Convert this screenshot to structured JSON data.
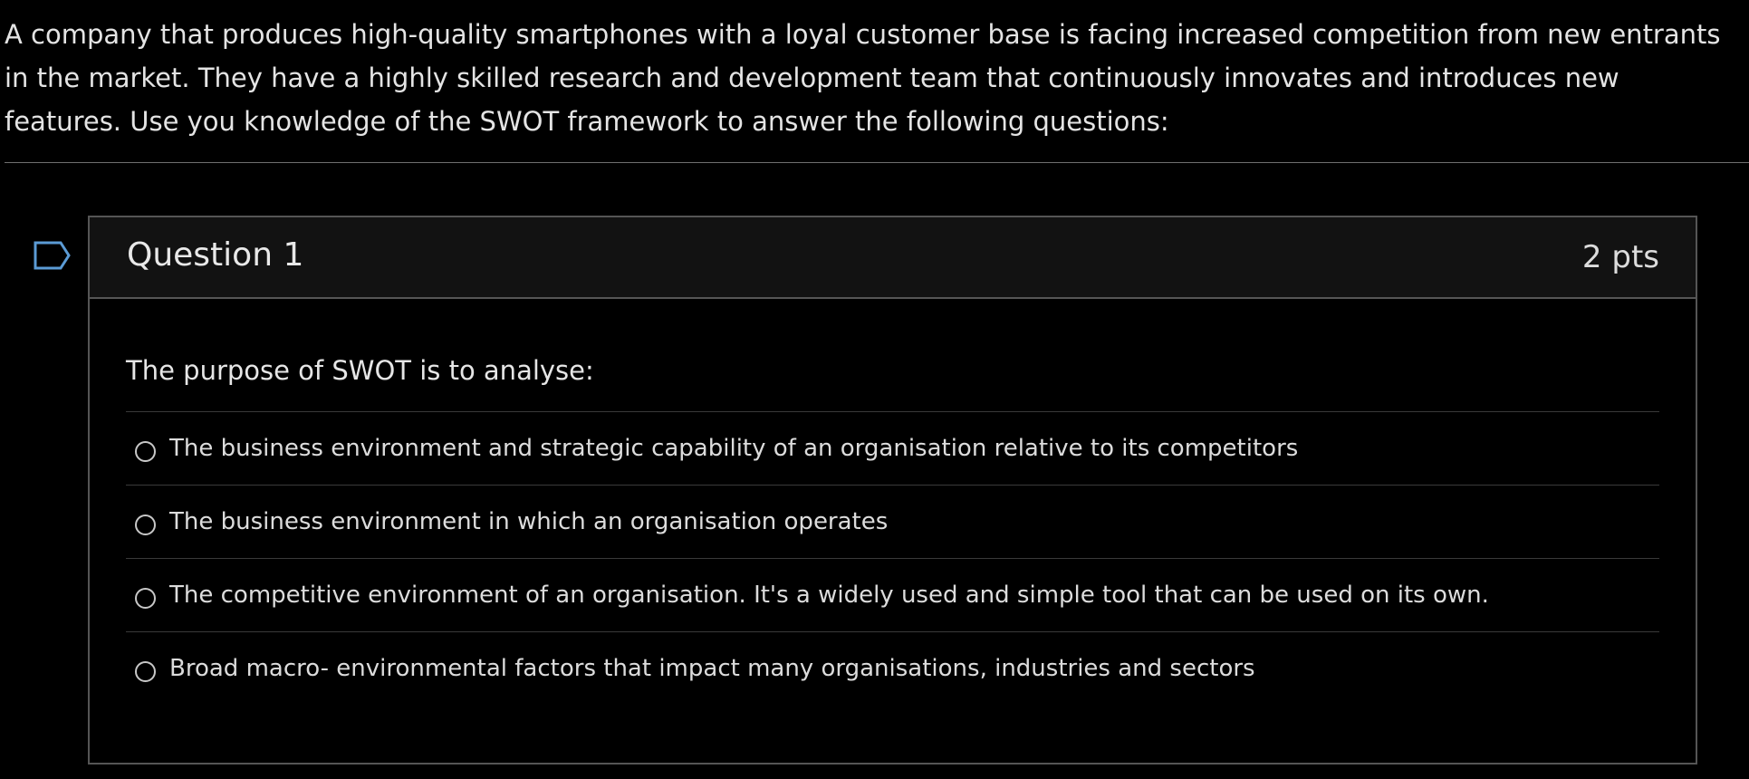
{
  "intro": {
    "text": "A company that produces high-quality smartphones with a loyal customer base is facing increased competition from new entrants in the market. They have a highly skilled research and development team that continuously innovates and introduces new features. Use you knowledge of the SWOT framework to answer the following questions:"
  },
  "flag": {
    "icon": "bookmark-flag-icon",
    "color": "#5b9bd5"
  },
  "question": {
    "title": "Question 1",
    "points": "2 pts",
    "text": "The purpose of SWOT is to analyse:",
    "answers": [
      {
        "label": "The business environment and strategic capability of an organisation relative to its competitors",
        "selected": false
      },
      {
        "label": "The business environment in which an organisation operates",
        "selected": false
      },
      {
        "label": "The competitive environment of an organisation. It's a widely used and simple tool that can be used on its own.",
        "selected": false
      },
      {
        "label": "Broad macro- environmental factors that impact many organisations, industries and sectors",
        "selected": false
      }
    ]
  }
}
